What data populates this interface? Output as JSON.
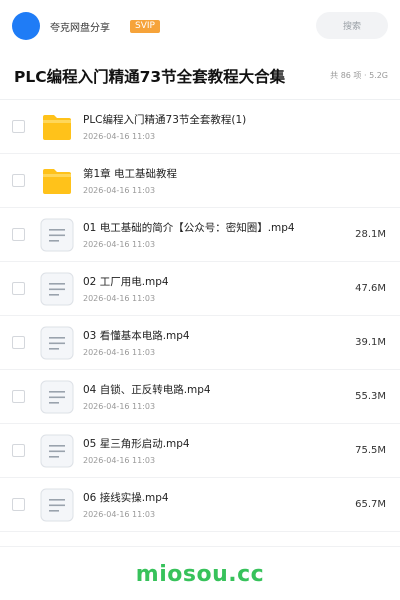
{
  "header": {
    "brand": "夸克网盘分享",
    "badge": "SVIP",
    "search_placeholder": "搜索"
  },
  "share": {
    "title": "PLC编程入门精通73节全套教程大合集",
    "meta": "共 86 项 · 5.2G"
  },
  "items": [
    {
      "type": "folder",
      "name": "PLC编程入门精通73节全套教程(1)",
      "date": "2026-04-16 11:03",
      "size": ""
    },
    {
      "type": "folder",
      "name": "第1章 电工基础教程",
      "date": "2026-04-16 11:03",
      "size": ""
    },
    {
      "type": "file",
      "name": "01 电工基础的简介【公众号：密知圈】.mp4",
      "date": "2026-04-16 11:03",
      "size": "28.1M"
    },
    {
      "type": "file",
      "name": "02 工厂用电.mp4",
      "date": "2026-04-16 11:03",
      "size": "47.6M"
    },
    {
      "type": "file",
      "name": "03 看懂基本电路.mp4",
      "date": "2026-04-16 11:03",
      "size": "39.1M"
    },
    {
      "type": "file",
      "name": "04 自锁、正反转电路.mp4",
      "date": "2026-04-16 11:03",
      "size": "55.3M"
    },
    {
      "type": "file",
      "name": "05 星三角形启动.mp4",
      "date": "2026-04-16 11:03",
      "size": "75.5M"
    },
    {
      "type": "file",
      "name": "06 接线实操.mp4",
      "date": "2026-04-16 11:03",
      "size": "65.7M"
    }
  ],
  "watermark": "miosou.cc",
  "colors": {
    "accent": "#1f7cf6",
    "badge": "#f6a33a",
    "folder": "#ffc21a",
    "watermark": "#37c25b"
  }
}
